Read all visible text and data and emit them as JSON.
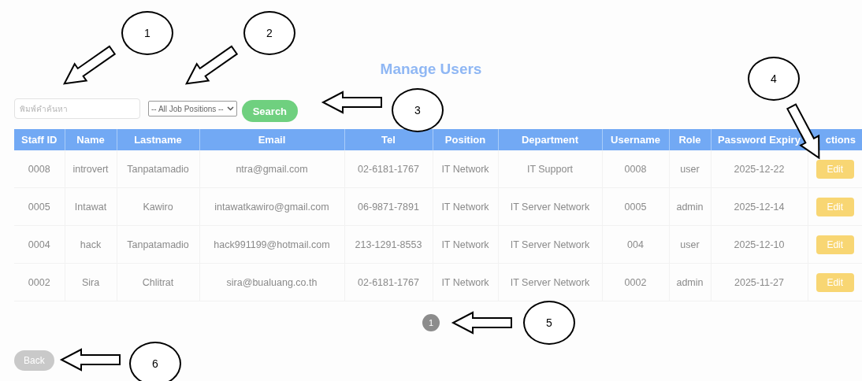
{
  "title": "Manage Users",
  "search": {
    "placeholder": "พิมพ์คำค้นหา"
  },
  "position_filter": {
    "value": "-- All Job Positions --"
  },
  "search_button": "Search",
  "table": {
    "columns": [
      "Staff ID",
      "Name",
      "Lastname",
      "Email",
      "Tel",
      "Position",
      "Department",
      "Username",
      "Role",
      "Password Expiry",
      "ctions"
    ],
    "rows": [
      {
        "cells": [
          "0008",
          "introvert",
          "Tanpatamadio",
          "ntra@gmail.com",
          "02-6181-1767",
          "IT Network",
          "IT Support",
          "0008",
          "user",
          "2025-12-22"
        ],
        "action": "Edit"
      },
      {
        "cells": [
          "0005",
          "Intawat",
          "Kawiro",
          "intawatkawiro@gmail.com",
          "06-9871-7891",
          "IT Network",
          "IT Server Network",
          "0005",
          "admin",
          "2025-12-14"
        ],
        "action": "Edit"
      },
      {
        "cells": [
          "0004",
          "hack",
          "Tanpatamadio",
          "hack991199@hotmail.com",
          "213-1291-8553",
          "IT Network",
          "IT Server Network",
          "004",
          "user",
          "2025-12-10"
        ],
        "action": "Edit"
      },
      {
        "cells": [
          "0002",
          "Sira",
          "Chlitrat",
          "sira@bualuang.co.th",
          "02-6181-1767",
          "IT Network",
          "IT Server Network",
          "0002",
          "admin",
          "2025-11-27"
        ],
        "action": "Edit"
      }
    ]
  },
  "pagination": [
    {
      "label": "1",
      "selected": true
    }
  ],
  "back_button": "Back",
  "callouts": [
    {
      "number": "1"
    },
    {
      "number": "2"
    },
    {
      "number": "3"
    },
    {
      "number": "4"
    },
    {
      "number": "5"
    },
    {
      "number": "6"
    }
  ]
}
